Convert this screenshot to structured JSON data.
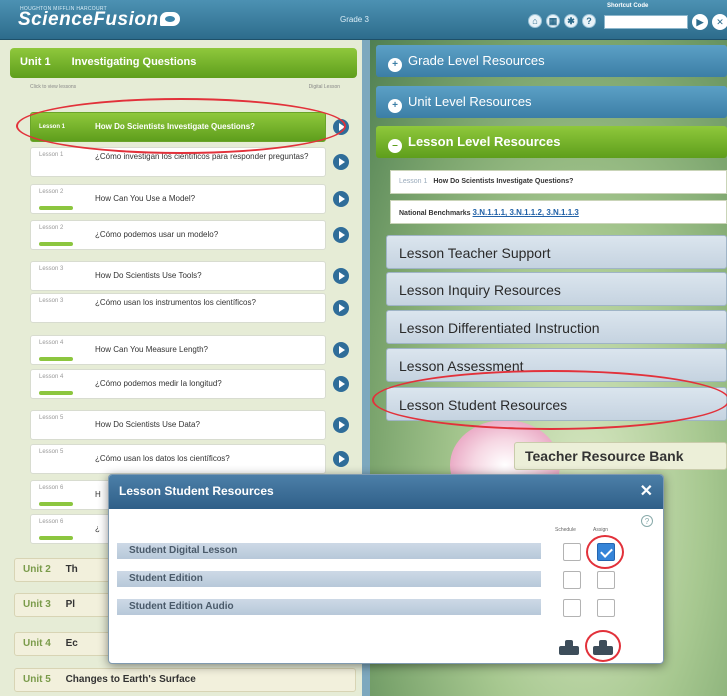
{
  "header": {
    "publisher_line": "HOUGHTON MIFFLIN HARCOURT",
    "logo_text": "ScienceFusion",
    "grade": "Grade 3",
    "icons": [
      "home-icon",
      "calendar-icon",
      "settings-icon",
      "help-icon"
    ],
    "shortcut_label": "Shortcut Code",
    "shortcut_value": "",
    "go_icon": "play-icon",
    "close_icon": "close-icon"
  },
  "left": {
    "unit1": {
      "num": "Unit 1",
      "title": "Investigating Questions"
    },
    "list_hint": "Click to view lessons",
    "list_right_label": "Digital Lesson",
    "lessons": [
      {
        "num": "Lesson 1",
        "title": "How Do Scientists Investigate Questions?"
      },
      {
        "num": "Lesson 1",
        "title": "¿Cómo investigan los científicos para responder preguntas?"
      },
      {
        "num": "Lesson 2",
        "title": "How Can You Use a Model?"
      },
      {
        "num": "Lesson 2",
        "title": "¿Cómo podemos usar un modelo?"
      },
      {
        "num": "Lesson 3",
        "title": "How Do Scientists Use Tools?"
      },
      {
        "num": "Lesson 3",
        "title": "¿Cómo usan los instrumentos los científicos?"
      },
      {
        "num": "Lesson 4",
        "title": "How Can You Measure Length?"
      },
      {
        "num": "Lesson 4",
        "title": "¿Cómo podemos medir la longitud?"
      },
      {
        "num": "Lesson 5",
        "title": "How Do Scientists Use Data?"
      },
      {
        "num": "Lesson 5",
        "title": "¿Cómo usan los datos los científicos?"
      },
      {
        "num": "Lesson 6",
        "title": "H"
      },
      {
        "num": "Lesson 6",
        "title": "¿"
      }
    ],
    "units": [
      {
        "num": "Unit 2",
        "title": "Th"
      },
      {
        "num": "Unit 3",
        "title": "Pl"
      },
      {
        "num": "Unit 4",
        "title": "Ec"
      },
      {
        "num": "Unit 5",
        "title": "Changes to Earth's Surface"
      }
    ]
  },
  "right": {
    "grade_level": "Grade Level Resources",
    "unit_level": "Unit Level Resources",
    "lesson_level": "Lesson Level Resources",
    "lesson_info_num": "Lesson 1",
    "lesson_info_title": "How Do Scientists Investigate Questions?",
    "benchmarks_label": "National Benchmarks",
    "benchmarks_links": "3.N.1.1.1, 3.N.1.1.2, 3.N.1.1.3",
    "sections": [
      "Lesson Teacher Support",
      "Lesson Inquiry Resources",
      "Lesson Differentiated Instruction",
      "Lesson Assessment",
      "Lesson Student Resources"
    ],
    "teacher_resource_bank": "Teacher Resource Bank"
  },
  "modal": {
    "title": "Lesson Student Resources",
    "col_schedule": "Schedule",
    "col_assign": "Assign",
    "rows": [
      {
        "label": "Student Digital Lesson",
        "schedule": false,
        "assign": true
      },
      {
        "label": "Student Edition",
        "schedule": false,
        "assign": false
      },
      {
        "label": "Student Edition Audio",
        "schedule": false,
        "assign": false
      }
    ],
    "help_icon": "help-icon",
    "buttons": [
      "schedule-icon",
      "assign-icon"
    ]
  },
  "colors": {
    "accent_green": "#7cb832",
    "accent_blue": "#3c7ea6",
    "highlight_red": "#e2313a"
  }
}
